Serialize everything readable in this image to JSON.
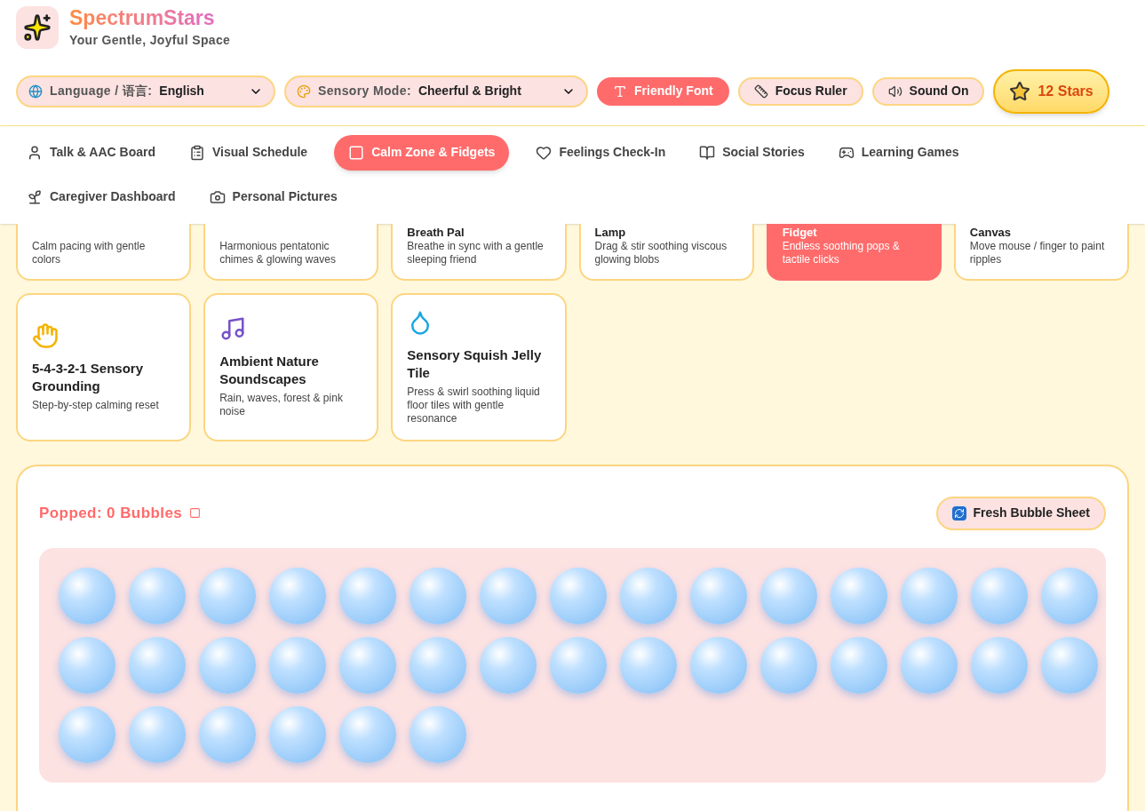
{
  "brand": {
    "title": "SpectrumStars",
    "subtitle": "Your Gentle, Joyful Space"
  },
  "toolbar": {
    "language": {
      "label": "Language / 语言:",
      "value": "English"
    },
    "sensory_mode": {
      "label": "Sensory Mode:",
      "value": "Cheerful & Bright"
    },
    "toggles": [
      {
        "kind": "font",
        "label": "Friendly Font",
        "on": true
      },
      {
        "kind": "ruler",
        "label": "Focus Ruler",
        "on": false
      },
      {
        "kind": "sound",
        "label": "Sound On",
        "on": false
      }
    ],
    "stars": "12 Stars"
  },
  "nav": [
    {
      "kind": "talk",
      "label": "Talk & AAC Board",
      "selected": false
    },
    {
      "kind": "schedule",
      "label": "Visual Schedule",
      "selected": false
    },
    {
      "kind": "calm",
      "label": "Calm Zone & Fidgets",
      "selected": true
    },
    {
      "kind": "feelings",
      "label": "Feelings Check-In",
      "selected": false
    },
    {
      "kind": "stories",
      "label": "Social Stories",
      "selected": false
    },
    {
      "kind": "games",
      "label": "Learning Games",
      "selected": false
    },
    {
      "kind": "caregiver",
      "label": "Caregiver Dashboard",
      "selected": false
    },
    {
      "kind": "pictures",
      "label": "Personal Pictures",
      "selected": false
    }
  ],
  "activities": [
    {
      "description": "Calm pacing with gentle colors",
      "selected": false
    },
    {
      "description": "Harmonious pentatonic chimes & glowing waves",
      "selected": false
    },
    {
      "title": "Breath Pal",
      "description": "Breathe in sync with a gentle sleeping friend",
      "selected": false
    },
    {
      "title": "Lamp",
      "description": "Drag & stir soothing viscous glowing blobs",
      "selected": false
    },
    {
      "title": "Fidget",
      "description": "Endless soothing pops & tactile clicks",
      "selected": true
    },
    {
      "title": "Canvas",
      "description": "Move mouse / finger to paint ripples",
      "selected": false
    },
    {
      "kind": "hand",
      "title": "5-4-3-2-1 Sensory Grounding",
      "description": "Step-by-step calming reset",
      "selected": false
    },
    {
      "kind": "music",
      "title": "Ambient Nature Soundscapes",
      "description": "Rain, waves, forest & pink noise",
      "selected": false
    },
    {
      "kind": "drop",
      "title": "Sensory Squish Jelly Tile",
      "description": "Press & swirl soothing liquid floor tiles with gentle resonance",
      "selected": false
    }
  ],
  "bubble_panel": {
    "counter": "Popped: 0 Bubbles",
    "reset_button": "Fresh Bubble Sheet",
    "bubbles": [
      {
        "popped": false
      },
      {
        "popped": false
      },
      {
        "popped": false
      },
      {
        "popped": false
      },
      {
        "popped": false
      },
      {
        "popped": false
      },
      {
        "popped": false
      },
      {
        "popped": false
      },
      {
        "popped": false
      },
      {
        "popped": false
      },
      {
        "popped": false
      },
      {
        "popped": false
      },
      {
        "popped": false
      },
      {
        "popped": false
      },
      {
        "popped": false
      },
      {
        "popped": false
      },
      {
        "popped": false
      },
      {
        "popped": false
      },
      {
        "popped": false
      },
      {
        "popped": false
      },
      {
        "popped": false
      },
      {
        "popped": false
      },
      {
        "popped": false
      },
      {
        "popped": false
      },
      {
        "popped": false
      },
      {
        "popped": false
      },
      {
        "popped": false
      },
      {
        "popped": false
      },
      {
        "popped": false
      },
      {
        "popped": false
      },
      {
        "popped": false
      },
      {
        "popped": false
      },
      {
        "popped": false
      },
      {
        "popped": false
      },
      {
        "popped": false
      },
      {
        "popped": false
      }
    ]
  }
}
